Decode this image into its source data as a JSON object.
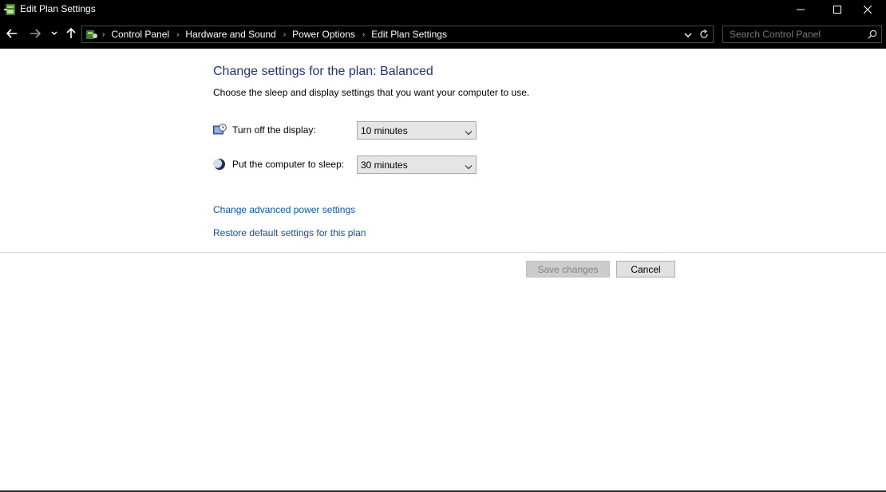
{
  "window": {
    "title": "Edit Plan Settings",
    "controls": [
      "minimize",
      "maximize",
      "close"
    ]
  },
  "address_bar": {
    "breadcrumbs": [
      "Control Panel",
      "Hardware and Sound",
      "Power Options",
      "Edit Plan Settings"
    ],
    "search_placeholder": "Search Control Panel"
  },
  "content": {
    "heading": "Change settings for the plan: Balanced",
    "subheading": "Choose the sleep and display settings that you want your computer to use.",
    "settings": [
      {
        "label": "Turn off the display:",
        "value": "10 minutes",
        "icon": "display-clock-icon"
      },
      {
        "label": "Put the computer to sleep:",
        "value": "30 minutes",
        "icon": "sleep-moon-icon"
      }
    ],
    "links": {
      "advanced": "Change advanced power settings",
      "restore": "Restore default settings for this plan"
    },
    "buttons": {
      "save": "Save changes",
      "cancel": "Cancel"
    }
  },
  "colors": {
    "heading": "#1e3287",
    "link": "#0b56a8",
    "chrome_background": "#000000"
  }
}
